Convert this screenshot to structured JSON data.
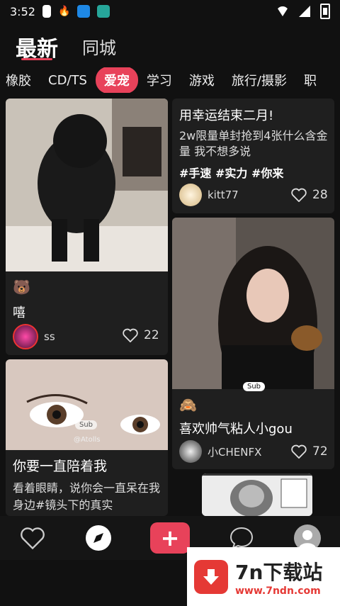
{
  "status": {
    "time": "3:52"
  },
  "header": {
    "tab_latest": "最新",
    "tab_city": "同城"
  },
  "categories": [
    "橡胶",
    "CD/TS",
    "爱宠",
    "学习",
    "游戏",
    "旅行/摄影",
    "职"
  ],
  "active_category": "爱宠",
  "cards": [
    {
      "emoji": "🐻",
      "title": "嘻",
      "author": "ss",
      "likes": "22"
    },
    {
      "title": "用幸运结束二月!",
      "desc": "2w限量单封抢到4张什么含金量 我不想多说",
      "tags": "#手速 #实力 #你来",
      "author": "kitt77",
      "likes": "28"
    },
    {
      "emoji": "🙈",
      "title": "喜欢帅气粘人小gou",
      "author": "小CHENFX",
      "likes": "72"
    },
    {
      "title": "你要一直陪着我",
      "desc": "看着眼睛，说你会一直呆在我身边#镜头下的真实"
    }
  ],
  "photo_badges": {
    "sub": "Sub",
    "atolls": "@Atolls"
  },
  "bottom_nav": {
    "plus": "+"
  },
  "watermark": {
    "title": "7n下载站",
    "url": "www.7ndn.com"
  },
  "colors": {
    "accent": "#e8425a"
  }
}
